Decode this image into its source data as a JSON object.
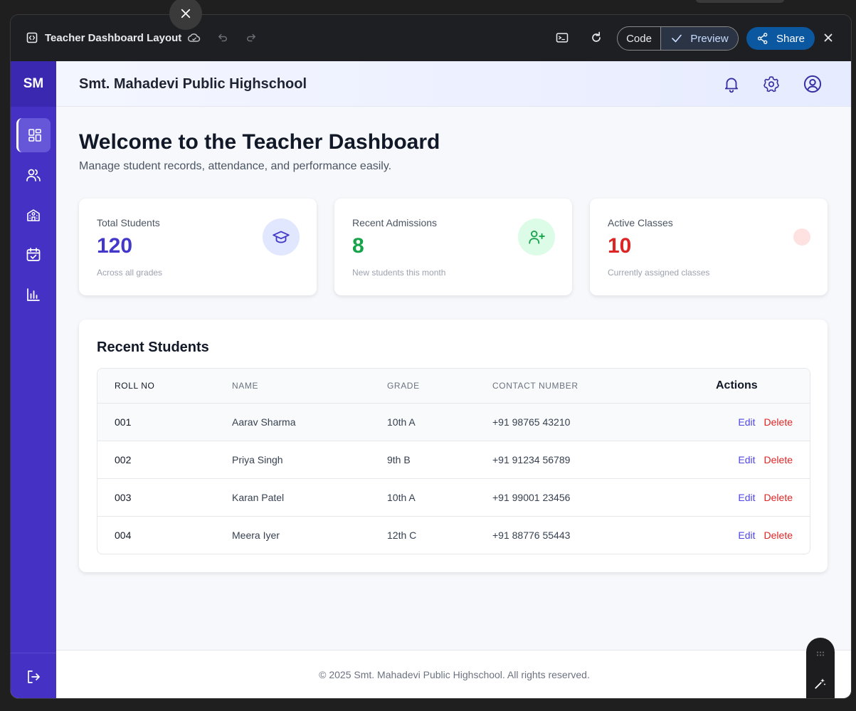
{
  "toolbar": {
    "title": "Teacher Dashboard Layout",
    "code_label": "Code",
    "preview_label": "Preview",
    "share_label": "Share"
  },
  "sidebar": {
    "logo": "SM",
    "items": [
      {
        "icon": "dashboard-icon",
        "active": true
      },
      {
        "icon": "users-icon",
        "active": false
      },
      {
        "icon": "school-icon",
        "active": false
      },
      {
        "icon": "calendar-check-icon",
        "active": false
      },
      {
        "icon": "bar-chart-icon",
        "active": false
      }
    ],
    "bottom_icon": "logout-icon"
  },
  "header": {
    "school_name": "Smt. Mahadevi Public Highschool",
    "icons": [
      "bell-icon",
      "gear-icon",
      "user-circle-icon"
    ]
  },
  "main": {
    "welcome": "Welcome to the Teacher Dashboard",
    "subtitle": "Manage student records, attendance, and performance easily.",
    "cards": [
      {
        "label": "Total Students",
        "value": "120",
        "note": "Across all grades",
        "color": "#4338ca",
        "icon": "graduation-cap-icon"
      },
      {
        "label": "Recent Admissions",
        "value": "8",
        "note": "New students this month",
        "color": "#16a34a",
        "icon": "user-plus-icon"
      },
      {
        "label": "Active Classes",
        "value": "10",
        "note": "Currently assigned classes",
        "color": "#dc2626",
        "icon": "dot-icon"
      }
    ]
  },
  "table": {
    "title": "Recent Students",
    "columns": [
      "ROLL NO",
      "NAME",
      "GRADE",
      "CONTACT NUMBER",
      "Actions"
    ],
    "rows": [
      {
        "roll": "001",
        "name": "Aarav Sharma",
        "grade": "10th A",
        "contact": "+91 98765 43210"
      },
      {
        "roll": "002",
        "name": "Priya Singh",
        "grade": "9th B",
        "contact": "+91 91234 56789"
      },
      {
        "roll": "003",
        "name": "Karan Patel",
        "grade": "10th A",
        "contact": "+91 99001 23456"
      },
      {
        "roll": "004",
        "name": "Meera Iyer",
        "grade": "12th C",
        "contact": "+91 88776 55443"
      }
    ],
    "edit_label": "Edit",
    "delete_label": "Delete"
  },
  "footer": {
    "text": "© 2025 Smt. Mahadevi Public Highschool. All rights reserved."
  },
  "colors": {
    "sidebar": "#4532c4",
    "accent": "#4f46e5",
    "danger": "#dc2626",
    "success": "#16a34a",
    "share_button": "#0b57a0"
  }
}
